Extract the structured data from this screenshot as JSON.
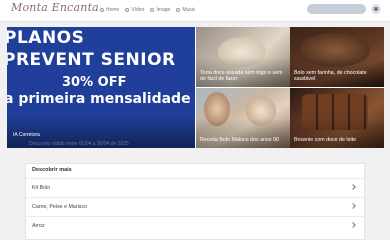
{
  "header": {
    "logo": "Monta Encanta",
    "nav": [
      "Home",
      "Vídeo",
      "Image",
      "Music"
    ],
    "search_placeholder": ""
  },
  "hero": {
    "main": {
      "promo_lines": [
        "PLANOS",
        "PREVENT SENIOR",
        "30% OFF",
        "a primeira mensalidade"
      ],
      "label": "IA Corretora",
      "date": "Desconto válido entre 01/04 a 30/04 de 2025"
    },
    "tiles": [
      {
        "label": "Torta doce assada sem trigo e sem de fácil de fazer"
      },
      {
        "label": "Bolo sem farinha, de chocolate saudável"
      },
      {
        "label": "Receita Bolo Maluco dos anos 90"
      },
      {
        "label": "Brownie com doce de leite"
      }
    ]
  },
  "discover": {
    "title": "Descobrir mais",
    "items": [
      "Kit Bolo",
      "Carne, Peixe e Marisco",
      "Arroz"
    ]
  },
  "colors": {
    "promo_bg": "#1f3f9a",
    "page_bg": "#f1f1f1",
    "search_bg": "#c5cdd6"
  }
}
